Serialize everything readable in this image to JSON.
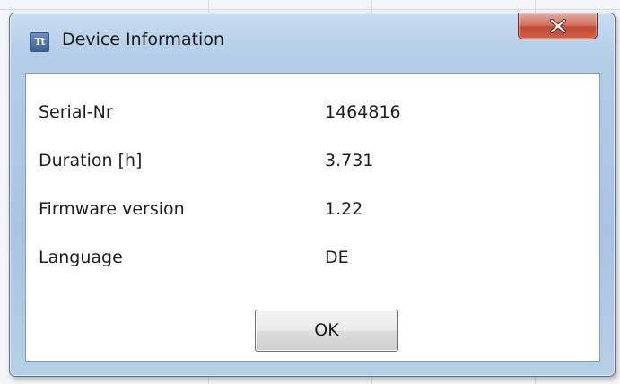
{
  "window": {
    "title": "Device Information",
    "app_icon_text": "Tt",
    "close_icon": "close-icon"
  },
  "info": {
    "rows": [
      {
        "label": "Serial-Nr",
        "value": "1464816"
      },
      {
        "label": "Duration [h]",
        "value": "3.731"
      },
      {
        "label": "Firmware version",
        "value": "1.22"
      },
      {
        "label": "Language",
        "value": "DE"
      }
    ]
  },
  "actions": {
    "ok_label": "OK"
  },
  "colors": {
    "title_bar": "#b3cde8",
    "close_button": "#c24a34",
    "content_background": "#ffffff"
  }
}
